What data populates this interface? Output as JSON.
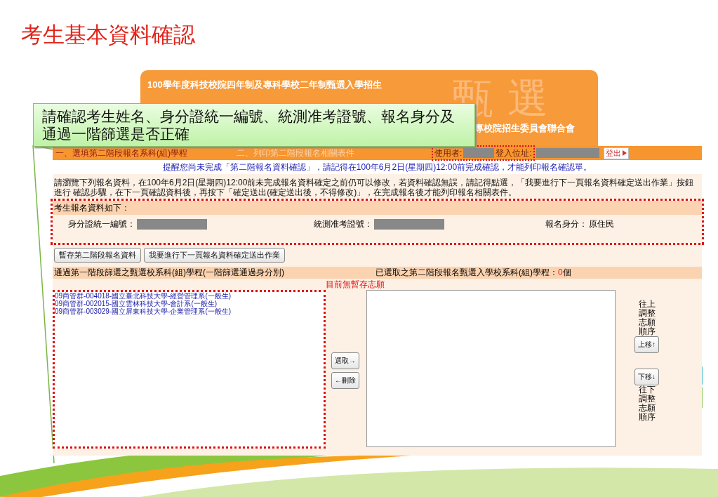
{
  "slide_title": "考生基本資料確認",
  "banner": {
    "subtitle": "100學年度科技校院四年制及專科學校二年制甄選入學招生",
    "mark": "甄選",
    "organizer": "專校院招生委員會聯合會"
  },
  "callout": "請確認考生姓名、身分證統一編號、統測准考證號、報名身分及通過一階篩選是否正確",
  "nav": {
    "steps": [
      {
        "label": "一、選填第二階段報名系科(組)學程",
        "selected": true
      },
      {
        "label": "二、列印第二階段報名相關表件",
        "selected": false
      }
    ],
    "user_label": "使用者:",
    "login_label": "登入位址:",
    "logout": "登出"
  },
  "reminder": "提醒您尚未完成「第二階報名資料確認」，請記得在100年6月2日(星期四)12:00前完成確認，才能列印報名確認單。",
  "instructions": "請瀏覽下列報名資料，在100年6月2日(星期四)12:00前未完成報名資料確定之前仍可以修改，若資料確認無誤，請記得點選，「我要進行下一頁報名資料確定送出作業」按鈕進行 確認步驟，在下一頁確認資料後，再按下「確定送出(確定送出後，不得修改)」，在完成報名後才能列印報名相關表件。",
  "applicant": {
    "heading": "考生報名資料如下：",
    "fields": [
      {
        "label": "身分證統一編號：",
        "kind": "redacted"
      },
      {
        "label": "統測准考證號：",
        "kind": "redacted"
      },
      {
        "label": "報名身分：",
        "kind": "text",
        "value": "原住民"
      }
    ]
  },
  "actions": [
    "暫存第二階段報名資料",
    "我要進行下一頁報名資料確定送出作業"
  ],
  "passed": {
    "heading": "通過第一階段篩選之甄選校系科(組)學程(一階篩選通過身分別)",
    "items": [
      "09商管群-004018-國立臺北科技大學-經營管理系(一般生)",
      "09商管群-002015-國立雲林科技大學-會計系(一般生)",
      "09商管群-003029-國立屏東科技大學-企業管理系(一般生)"
    ]
  },
  "chosen": {
    "heading": "已選取之第二階段報名甄選入學校系科(組)學程：",
    "count": "0",
    "unit": "個",
    "empty_note": "目前無暫存志願"
  },
  "transfer_buttons": [
    "選取→",
    "←刪除"
  ],
  "order": {
    "up_hint": "往上調整志願順序",
    "up": "上移↑",
    "down": "下移↓",
    "down_hint": "往下調整志願順序"
  }
}
